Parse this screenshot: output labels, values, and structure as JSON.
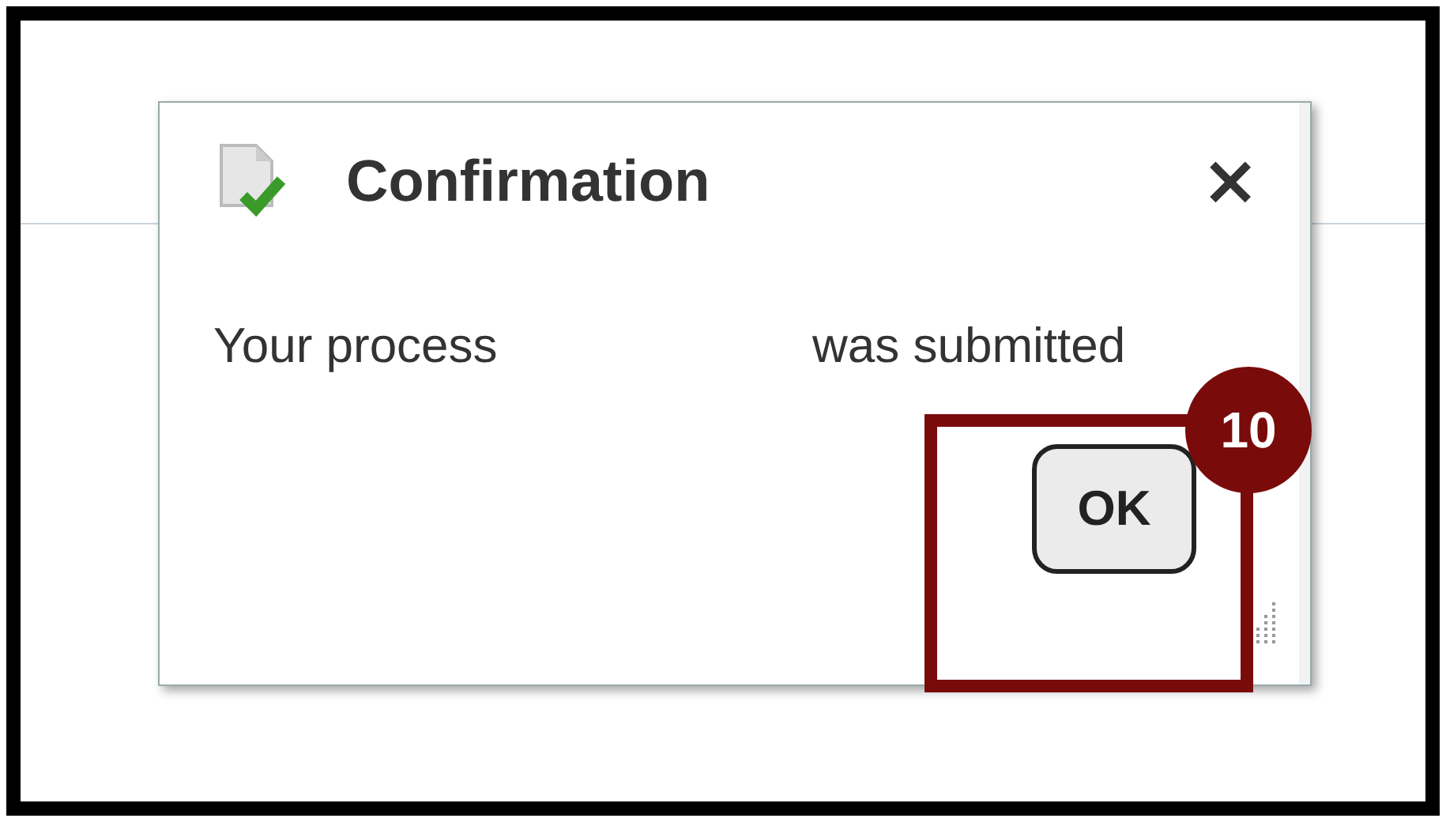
{
  "dialog": {
    "title": "Confirmation",
    "close": "×",
    "message": [
      "Your process",
      "was submitted"
    ],
    "buttons": [
      {
        "label": "OK"
      }
    ]
  },
  "annotation": {
    "number": "10"
  }
}
